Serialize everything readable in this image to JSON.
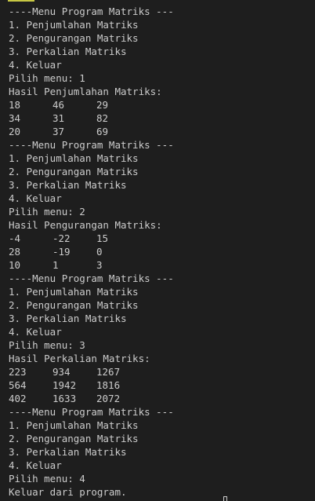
{
  "terminal": {
    "blocks": [
      {
        "menu": {
          "title": "----Menu Program Matriks ---",
          "items": [
            "1. Penjumlahan Matriks",
            "2. Pengurangan Matriks",
            "3. Perkalian Matriks",
            "4. Keluar"
          ]
        },
        "prompt": "Pilih menu: 1",
        "result_title": "Hasil Penjumlahan Matriks:",
        "matrix": [
          [
            "18",
            "46",
            "29"
          ],
          [
            "34",
            "31",
            "82"
          ],
          [
            "20",
            "37",
            "69"
          ]
        ]
      },
      {
        "menu": {
          "title": "----Menu Program Matriks ---",
          "items": [
            "1. Penjumlahan Matriks",
            "2. Pengurangan Matriks",
            "3. Perkalian Matriks",
            "4. Keluar"
          ]
        },
        "prompt": "Pilih menu: 2",
        "result_title": "Hasil Pengurangan Matriks:",
        "matrix": [
          [
            "-4",
            "-22",
            "15"
          ],
          [
            "28",
            "-19",
            "0"
          ],
          [
            "10",
            "1",
            "3"
          ]
        ]
      },
      {
        "menu": {
          "title": "----Menu Program Matriks ---",
          "items": [
            "1. Penjumlahan Matriks",
            "2. Pengurangan Matriks",
            "3. Perkalian Matriks",
            "4. Keluar"
          ]
        },
        "prompt": "Pilih menu: 3",
        "result_title": "Hasil Perkalian Matriks:",
        "matrix": [
          [
            "223",
            "934",
            "1267"
          ],
          [
            "564",
            "1942",
            "1816"
          ],
          [
            "402",
            "1633",
            "2072"
          ]
        ]
      }
    ],
    "final_menu": {
      "title": "----Menu Program Matriks ---",
      "items": [
        "1. Penjumlahan Matriks",
        "2. Pengurangan Matriks",
        "3. Perkalian Matriks",
        "4. Keluar"
      ]
    },
    "final_prompt": "Pilih menu: 4",
    "exit_message": "Keluar dari program.",
    "colors": {
      "background": "#1e1e1e",
      "text": "#cccccc"
    }
  }
}
